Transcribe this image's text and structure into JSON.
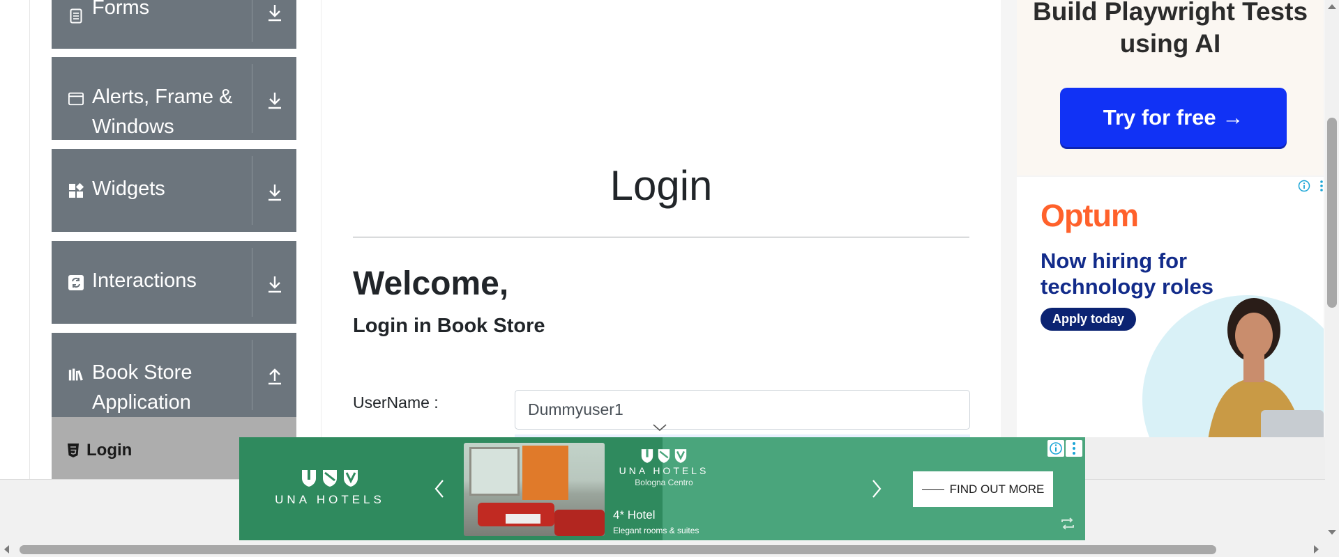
{
  "sidebar": {
    "groups": [
      {
        "label": "Forms",
        "toggle": "expand"
      },
      {
        "label": "Alerts, Frame & Windows",
        "toggle": "expand"
      },
      {
        "label": "Widgets",
        "toggle": "expand"
      },
      {
        "label": "Interactions",
        "toggle": "expand"
      },
      {
        "label": "Book Store Application",
        "toggle": "collapse"
      }
    ],
    "active_item": {
      "label": "Login"
    }
  },
  "main": {
    "title": "Login",
    "welcome": "Welcome,",
    "subheading": "Login in Book Store",
    "username_label": "UserName :",
    "username_value": "Dummyuser1"
  },
  "ads": {
    "playwright": {
      "headline": "Build Playwright Tests using AI",
      "button": "Try for free →"
    },
    "optum": {
      "logo": "Optum",
      "headline": "Now hiring for technology roles",
      "button": "Apply today"
    },
    "hotel": {
      "brand": "UNA HOTELS",
      "location": "Bologna Centro",
      "rating": "4* Hotel",
      "tagline": "Elegant rooms & suites",
      "cta": "FIND OUT MORE"
    }
  },
  "colors": {
    "sidebar_group": "#6c757d",
    "sidebar_active": "#adadad",
    "playwright_button": "#1132f5",
    "optum_orange": "#ff612b",
    "optum_navy": "#122b8a",
    "hotel_green": "#2f8a5e"
  }
}
